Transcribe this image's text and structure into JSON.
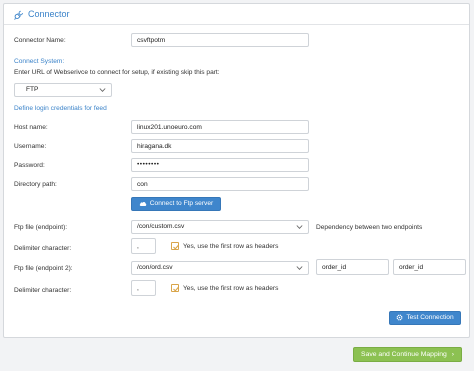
{
  "panel": {
    "title": "Connector"
  },
  "connector_name": {
    "label": "Connector Name:",
    "value": "csvftpotm"
  },
  "connect_system": {
    "heading": "Connect System:",
    "hint": "Enter URL of Webserivce to connect for setup, if existing skip this part:",
    "selected": "FTP"
  },
  "credentials": {
    "heading": "Define login credentials for feed",
    "host_label": "Host name:",
    "host_value": "linux201.unoeuro.com",
    "username_label": "Username:",
    "username_value": "hiragana.dk",
    "password_label": "Password:",
    "password_value": "••••••••",
    "directory_label": "Directory path:",
    "directory_value": "con",
    "connect_button": "Connect to Ftp server"
  },
  "endpoint1": {
    "label": "Ftp file (endpoint):",
    "selected": "/con/custom.csv",
    "dependency_text": "Dependency between two endpoints",
    "delimiter_label": "Delimiter character:",
    "delimiter_value": ",",
    "headers_text": "Yes, use the first row as headers"
  },
  "endpoint2": {
    "label": "Ftp file (endpoint 2):",
    "selected": "/con/ord.csv",
    "key1": "order_id",
    "key2": "order_id",
    "delimiter_label": "Delimiter character:",
    "delimiter_value": ",",
    "headers_text": "Yes, use the first row as headers"
  },
  "buttons": {
    "test_connection": "Test Connection",
    "save_continue": "Save and Continue Mapping"
  },
  "colors": {
    "accent": "#3b83c9",
    "button_blue": "#3f86cc",
    "button_green": "#8cc152",
    "checkbox": "#d9a54a"
  }
}
